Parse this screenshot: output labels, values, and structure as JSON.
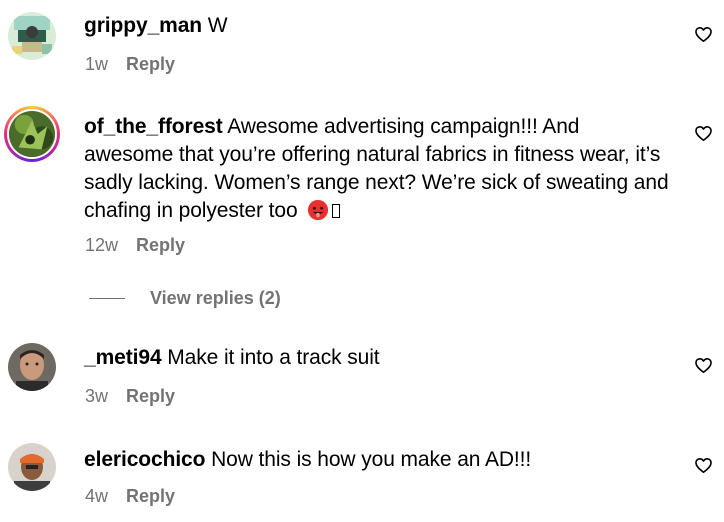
{
  "comments": [
    {
      "username": "grippy_man",
      "text": "W",
      "time": "1w",
      "reply_label": "Reply",
      "avatar": "avatar-grippy-man",
      "like_icon": "heart-outline-icon"
    },
    {
      "username": "of_the_fforest",
      "text": "Awesome advertising campaign!!! And awesome that you’re offering natural fabrics in fitness wear, it’s sadly lacking. Women’s range next? We’re sick of sweating and chafing in polyester too",
      "emoji": "hot-face-emoji",
      "time": "12w",
      "reply_label": "Reply",
      "avatar": "avatar-of-the-fforest",
      "like_icon": "heart-outline-icon"
    },
    {
      "username": "_meti94",
      "text": "Make it into a track suit",
      "time": "3w",
      "reply_label": "Reply",
      "avatar": "avatar-meti94",
      "like_icon": "heart-outline-icon"
    },
    {
      "username": "elericochico",
      "text": "Now this is how you make an AD!!!",
      "time": "4w",
      "reply_label": "Reply",
      "avatar": "avatar-elericochico",
      "like_icon": "heart-outline-icon"
    }
  ],
  "view_replies": {
    "label": "View replies (2)"
  },
  "colors": {
    "muted_text": "#737373",
    "story_ring": [
      "#f9ce34",
      "#ee2a7b",
      "#6228d7"
    ]
  }
}
